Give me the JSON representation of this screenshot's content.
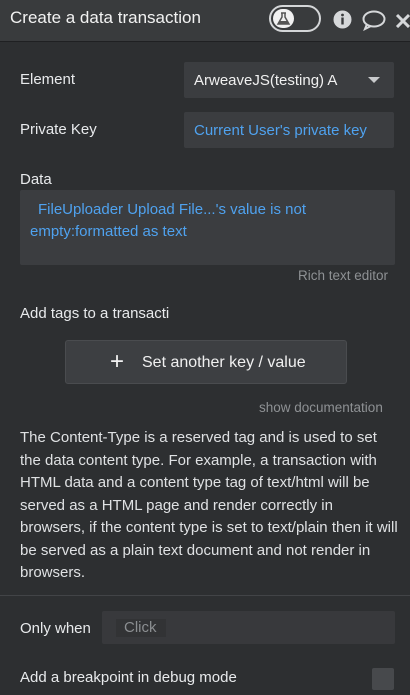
{
  "header": {
    "title": "Create a data transaction",
    "icons": [
      "flask-icon",
      "info-icon",
      "comment-icon",
      "close-icon"
    ]
  },
  "fields": {
    "element_label": "Element",
    "element_value": "ArweaveJS(testing) A",
    "private_key_label": "Private Key",
    "private_key_value": "Current User's private key",
    "data_label": "Data",
    "data_value_line1": "FileUploader Upload File...'s value is not",
    "data_value_line2": "empty:formatted as text",
    "rich_text_link": "Rich text editor",
    "tags_label": "Add tags to a transacti",
    "set_button_label": "Set another key / value",
    "show_doc_link": "show documentation"
  },
  "description": "The Content-Type is a reserved tag and is used to set the data content type. For example, a transaction with HTML data and a content type tag of text/html will be served as a HTML page and render correctly in browsers, if the content type is set to text/plain then it will be served as a plain text document and not render in browsers.",
  "footer": {
    "only_when_label": "Only when",
    "only_when_placeholder": "Click",
    "breakpoint_label": "Add a breakpoint in debug mode"
  },
  "colors": {
    "background": "#2d2f31",
    "header": "#393b3d",
    "dynamic_text": "#4fa2ef"
  }
}
